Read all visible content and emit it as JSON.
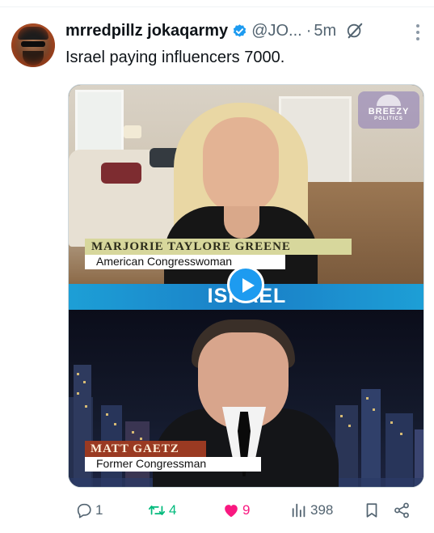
{
  "post": {
    "display_name": "mrredpillz jokaqarmy",
    "handle": "@JO...",
    "separator": "·",
    "time": "5m",
    "text": "Israel paying influencers 7000.",
    "verified": true
  },
  "icons": {
    "verified": "verified-badge-icon",
    "grok": "grok-icon",
    "more": "more-vertical-icon",
    "reply": "reply-icon",
    "retweet": "retweet-icon",
    "like": "heart-icon",
    "views": "views-icon",
    "bookmark": "bookmark-icon",
    "share": "share-icon",
    "play": "play-icon"
  },
  "media": {
    "watermark_line1": "BREEZY",
    "watermark_line2": "POLITICS",
    "caption1_name": "MARJORIE TAYLORE GREENE",
    "caption1_title": "American Congresswoman",
    "banner": "ISRAEL",
    "caption2_name": "MATT GAETZ",
    "caption2_title": "Former Congressman"
  },
  "metrics": {
    "replies": "1",
    "reposts": "4",
    "likes": "9",
    "views": "398"
  },
  "colors": {
    "accent": "#1d9bf0",
    "retweet": "#00ba7c",
    "like": "#f91880",
    "muted": "#536471",
    "text": "#0f1419"
  }
}
